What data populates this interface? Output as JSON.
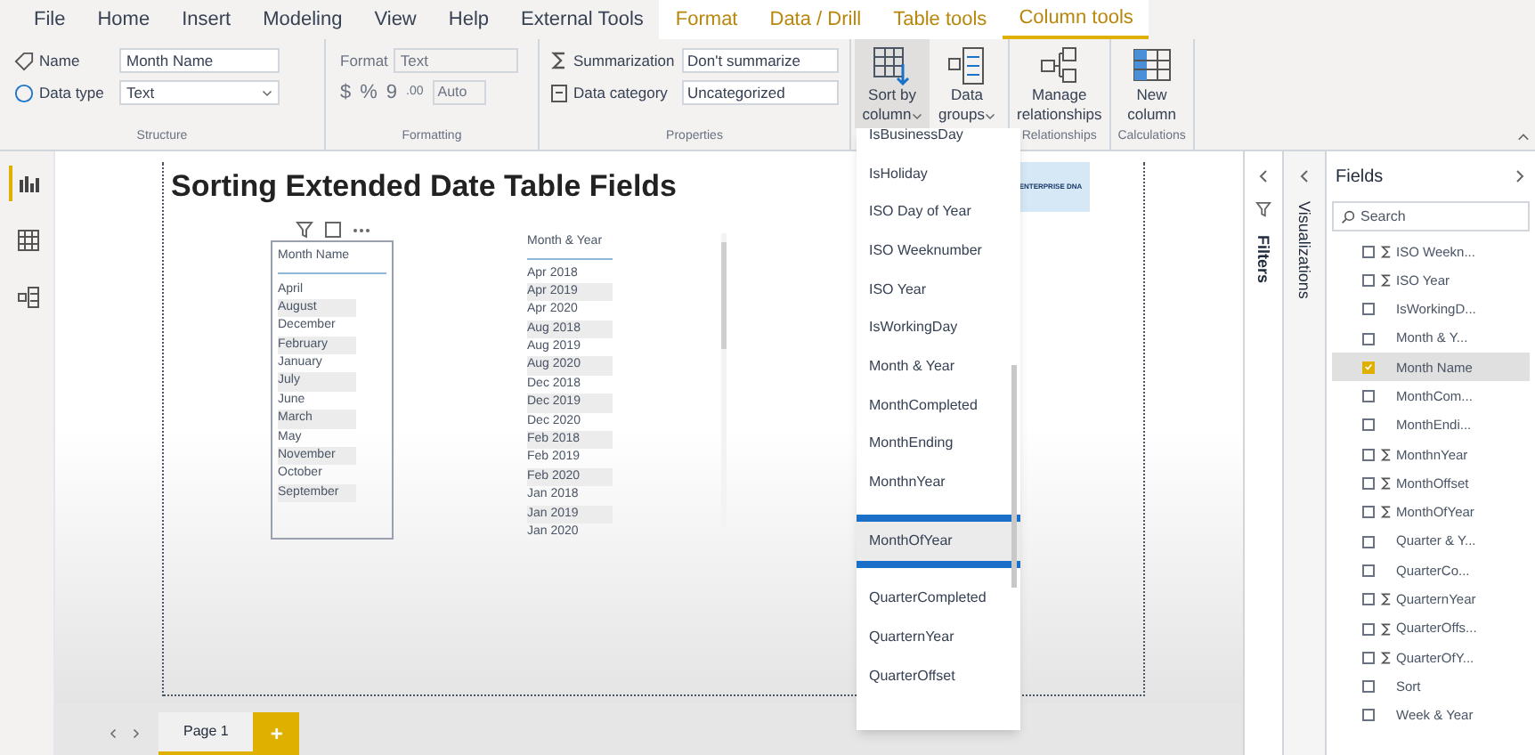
{
  "menu_tabs": [
    {
      "label": "File",
      "selected": false,
      "contextual": false
    },
    {
      "label": "Home",
      "selected": false,
      "contextual": false
    },
    {
      "label": "Insert",
      "selected": false,
      "contextual": false
    },
    {
      "label": "Modeling",
      "selected": false,
      "contextual": false
    },
    {
      "label": "View",
      "selected": false,
      "contextual": false
    },
    {
      "label": "Help",
      "selected": false,
      "contextual": false
    },
    {
      "label": "External Tools",
      "selected": false,
      "contextual": false
    },
    {
      "label": "Format",
      "selected": false,
      "contextual": true
    },
    {
      "label": "Data / Drill",
      "selected": false,
      "contextual": true
    },
    {
      "label": "Table tools",
      "selected": false,
      "contextual": true
    },
    {
      "label": "Column tools",
      "selected": true,
      "contextual": true
    }
  ],
  "ribbon": {
    "structure": {
      "name_label": "Name",
      "name_value": "Month Name",
      "type_label": "Data type",
      "type_value": "Text",
      "caption": "Structure"
    },
    "formatting": {
      "format_label": "Format",
      "format_value": "Text",
      "currency": "$",
      "percent": "%",
      "comma": "9",
      "decimals": ".00",
      "auto": "Auto",
      "caption": "Formatting",
      "disabled": true
    },
    "properties": {
      "summarization_label": "Summarization",
      "summarization_value": "Don't summarize",
      "category_label": "Data category",
      "category_value": "Uncategorized",
      "caption": "Properties"
    },
    "big_buttons": [
      {
        "kind": "sort",
        "label": "Sort by",
        "label2": "column",
        "dropdown": true,
        "pressed": true
      },
      {
        "kind": "groups",
        "label": "Data",
        "label2": "groups",
        "dropdown": true,
        "pressed": false
      }
    ],
    "relationships": {
      "label": "Manage",
      "label2": "relationships",
      "caption": "Relationships"
    },
    "calculations": {
      "label": "New",
      "label2": "column",
      "caption": "Calculations"
    }
  },
  "left_rail": [
    {
      "kind": "report",
      "selected": true
    },
    {
      "kind": "data",
      "selected": false
    },
    {
      "kind": "model",
      "selected": false
    }
  ],
  "canvas": {
    "title": "Sorting Extended Date Table Fields",
    "logo_text": "ENTERPRISE DNA",
    "slicer": {
      "header": "Month Name",
      "items": [
        "April",
        "August",
        "December",
        "February",
        "January",
        "July",
        "June",
        "March",
        "May",
        "November",
        "October",
        "September"
      ]
    },
    "table": {
      "header": "Month & Year",
      "rows": [
        "Apr 2018",
        "Apr 2019",
        "Apr 2020",
        "Aug 2018",
        "Aug 2019",
        "Aug 2020",
        "Dec 2018",
        "Dec 2019",
        "Dec 2020",
        "Feb 2018",
        "Feb 2019",
        "Feb 2020",
        "Jan 2018",
        "Jan 2019",
        "Jan 2020"
      ]
    }
  },
  "sort_menu": {
    "items": [
      {
        "label": "IsBusinessDay",
        "selected": false
      },
      {
        "label": "IsHoliday",
        "selected": false
      },
      {
        "label": "ISO Day of Year",
        "selected": false
      },
      {
        "label": "ISO Weeknumber",
        "selected": false
      },
      {
        "label": "ISO Year",
        "selected": false
      },
      {
        "label": "IsWorkingDay",
        "selected": false
      },
      {
        "label": "Month & Year",
        "selected": false
      },
      {
        "label": "MonthCompleted",
        "selected": false
      },
      {
        "label": "MonthEnding",
        "selected": false
      },
      {
        "label": "MonthnYear",
        "selected": false
      },
      {
        "label": "MonthOfYear",
        "selected": true
      },
      {
        "label": "QuarterCompleted",
        "selected": false
      },
      {
        "label": "QuarternYear",
        "selected": false
      },
      {
        "label": "QuarterOffset",
        "selected": false
      }
    ]
  },
  "filters_pane": {
    "label": "Filters"
  },
  "visualizations_pane": {
    "label": "Visualizations"
  },
  "fields_pane": {
    "title": "Fields",
    "search_placeholder": "Search",
    "items": [
      {
        "label": "ISO Weekn...",
        "sigma": true,
        "checked": false,
        "selected": false
      },
      {
        "label": "ISO Year",
        "sigma": true,
        "checked": false,
        "selected": false
      },
      {
        "label": "IsWorkingD...",
        "sigma": false,
        "checked": false,
        "selected": false
      },
      {
        "label": "Month & Y...",
        "sigma": false,
        "checked": false,
        "selected": false
      },
      {
        "label": "Month Name",
        "sigma": false,
        "checked": true,
        "selected": true
      },
      {
        "label": "MonthCom...",
        "sigma": false,
        "checked": false,
        "selected": false
      },
      {
        "label": "MonthEndi...",
        "sigma": false,
        "checked": false,
        "selected": false
      },
      {
        "label": "MonthnYear",
        "sigma": true,
        "checked": false,
        "selected": false
      },
      {
        "label": "MonthOffset",
        "sigma": true,
        "checked": false,
        "selected": false
      },
      {
        "label": "MonthOfYear",
        "sigma": true,
        "checked": false,
        "selected": false
      },
      {
        "label": "Quarter & Y...",
        "sigma": false,
        "checked": false,
        "selected": false
      },
      {
        "label": "QuarterCo...",
        "sigma": false,
        "checked": false,
        "selected": false
      },
      {
        "label": "QuarternYear",
        "sigma": true,
        "checked": false,
        "selected": false
      },
      {
        "label": "QuarterOffs...",
        "sigma": true,
        "checked": false,
        "selected": false
      },
      {
        "label": "QuarterOfY...",
        "sigma": true,
        "checked": false,
        "selected": false
      },
      {
        "label": "Sort",
        "sigma": false,
        "checked": false,
        "selected": false
      },
      {
        "label": "Week & Year",
        "sigma": false,
        "checked": false,
        "selected": false
      }
    ]
  },
  "page_tabs": [
    {
      "label": "Page 1",
      "selected": true
    }
  ],
  "add_page": "+"
}
